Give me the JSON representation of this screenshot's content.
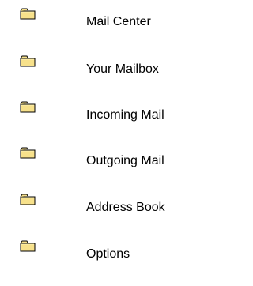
{
  "nav": {
    "items": [
      {
        "label": "Mail Center",
        "icon": "folder-icon"
      },
      {
        "label": "Your Mailbox",
        "icon": "folder-icon"
      },
      {
        "label": "Incoming Mail",
        "icon": "folder-icon"
      },
      {
        "label": "Outgoing Mail",
        "icon": "folder-icon"
      },
      {
        "label": "Address Book",
        "icon": "folder-icon"
      },
      {
        "label": "Options",
        "icon": "folder-icon"
      }
    ]
  },
  "colors": {
    "folder_fill": "#f7e18b",
    "folder_outline": "#000000",
    "text": "#000000",
    "background": "#ffffff"
  }
}
